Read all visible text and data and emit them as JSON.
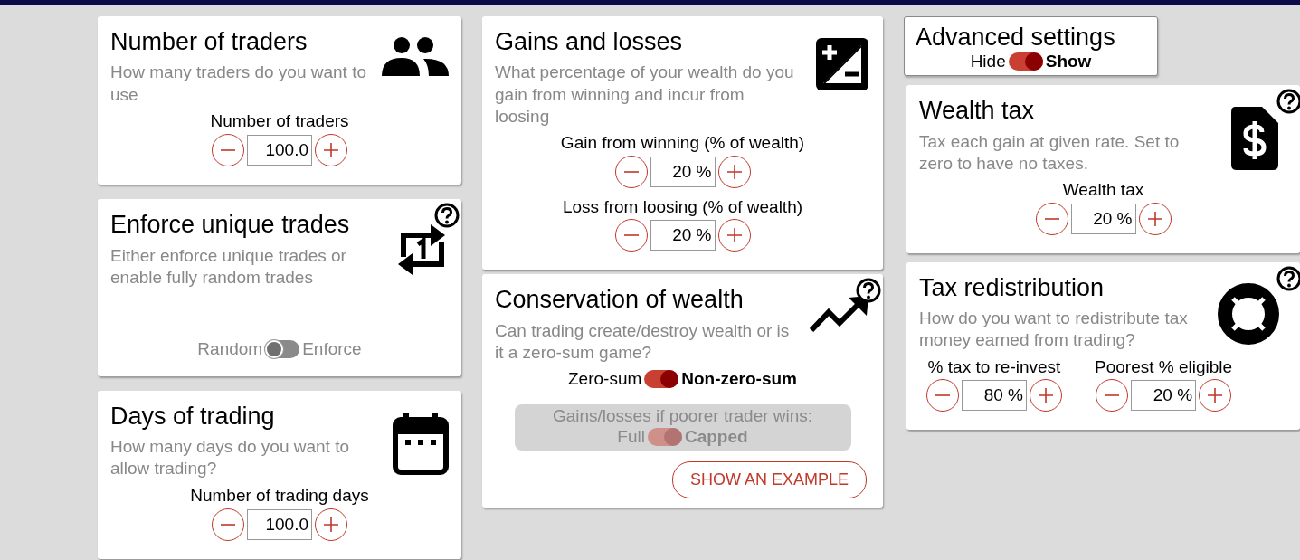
{
  "columns": [
    {
      "cards": [
        {
          "kind": "setting",
          "title": "Number of traders",
          "description": "How many traders do you want to use",
          "help": false,
          "controls": [
            {
              "kind": "stepper",
              "label": "Number of traders",
              "value": "100.0"
            }
          ]
        },
        {
          "kind": "setting",
          "title": "Enforce unique trades",
          "description": "Either enforce unique trades or enable fully random trades",
          "help": true,
          "controls": [
            {
              "kind": "toggle",
              "off_label": "Random",
              "on_label": "Enforce",
              "on": false
            }
          ]
        },
        {
          "kind": "setting",
          "title": "Days of trading",
          "description": "How many days do you want to allow trading?",
          "help": false,
          "controls": [
            {
              "kind": "stepper",
              "label": "Number of trading days",
              "value": "100.0"
            }
          ]
        }
      ]
    },
    {
      "cards": [
        {
          "kind": "setting",
          "title": "Gains and losses",
          "description": "What percentage of your wealth do you gain from winning and incur from loosing",
          "help": false,
          "controls": [
            {
              "kind": "stepper",
              "label": "Gain from winning (% of wealth)",
              "value": "20 %"
            },
            {
              "kind": "stepper",
              "label": "Loss from loosing (% of wealth)",
              "value": "20 %"
            }
          ]
        },
        {
          "kind": "setting",
          "title": "Conservation of wealth",
          "description": "Can trading create/destroy wealth or is it a zero-sum game?",
          "help": true,
          "controls": [
            {
              "kind": "toggle",
              "off_label": "Zero-sum",
              "on_label": "Non-zero-sum",
              "on": true
            },
            {
              "kind": "suboption",
              "label": "Gains/losses if poorer trader wins:",
              "off_label": "Full",
              "on_label": "Capped",
              "on": true,
              "disabled": true
            },
            {
              "kind": "button",
              "label": "SHOW AN EXAMPLE"
            }
          ]
        }
      ]
    },
    {
      "cards": [
        {
          "kind": "panel",
          "title": "Advanced settings",
          "controls": [
            {
              "kind": "toggle",
              "off_label": "Hide",
              "on_label": "Show",
              "on": true
            }
          ]
        },
        {
          "kind": "setting",
          "title": "Wealth tax",
          "description": "Tax each gain at given rate. Set to zero to have no taxes.",
          "help": true,
          "controls": [
            {
              "kind": "stepper",
              "label": "Wealth tax",
              "value": "20 %"
            }
          ]
        },
        {
          "kind": "setting",
          "title": "Tax redistribution",
          "description": "How do you want to redistribute tax money earned from trading?",
          "help": true,
          "controls": [
            {
              "kind": "stepper_pair",
              "items": [
                {
                  "label": "% tax to re-invest",
                  "value": "80 %"
                },
                {
                  "label": "Poorest % eligible",
                  "value": "20 %"
                }
              ]
            }
          ]
        }
      ]
    }
  ]
}
